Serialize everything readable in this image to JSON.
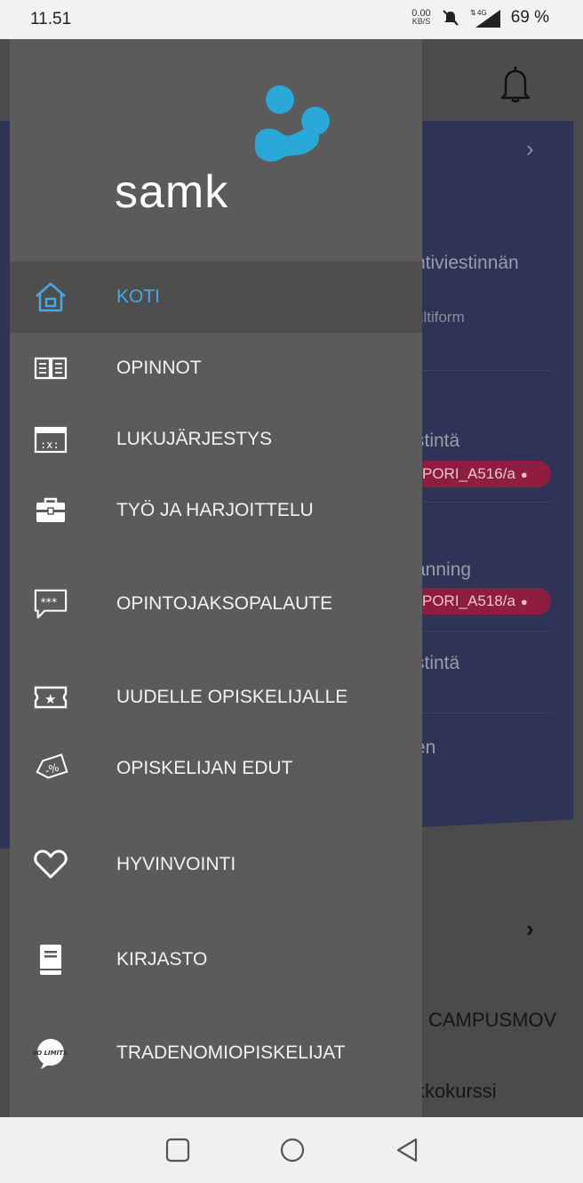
{
  "status_bar": {
    "time": "11.51",
    "net_speed_value": "0.00",
    "net_speed_unit": "KB/S",
    "network": "4G",
    "battery": "69 %"
  },
  "background_app": {
    "texts": [
      "ntiviestinnän",
      "ultiform",
      "stintä",
      "anning",
      "stintä",
      "en",
      "CAMPUSMOV",
      "kkokurssi"
    ],
    "rooms": [
      "PORI_A516/a",
      "PORI_A518/a"
    ]
  },
  "drawer": {
    "logo_text": "samk",
    "items": [
      {
        "label": "KOTI",
        "icon": "home-icon",
        "active": true
      },
      {
        "label": "OPINNOT",
        "icon": "open-book-icon",
        "active": false
      },
      {
        "label": "LUKUJÄRJESTYS",
        "icon": "calendar-icon",
        "active": false
      },
      {
        "label": "TYÖ JA HARJOITTELU",
        "icon": "briefcase-icon",
        "active": false
      },
      {
        "label": "OPINTOJAKSOPALAUTE",
        "icon": "feedback-stars-icon",
        "active": false
      },
      {
        "label": "UUDELLE OPISKELIJALLE",
        "icon": "ticket-star-icon",
        "active": false
      },
      {
        "label": "OPISKELIJAN EDUT",
        "icon": "discount-tag-icon",
        "active": false
      },
      {
        "label": "HYVINVOINTI",
        "icon": "heart-icon",
        "active": false
      },
      {
        "label": "KIRJASTO",
        "icon": "book-icon",
        "active": false
      },
      {
        "label": "TRADENOMIOPISKELIJAT",
        "icon": "no-limits-badge-icon",
        "active": false
      }
    ],
    "badge_text": "NO LIMITS."
  },
  "colors": {
    "drawer_bg": "#5b5b5b",
    "active_bg": "#4e4e4e",
    "accent": "#46a9e4",
    "logo_blue": "#29a8d8",
    "panel_bg": "#2f3356",
    "room_pill": "#8e1d3f"
  }
}
